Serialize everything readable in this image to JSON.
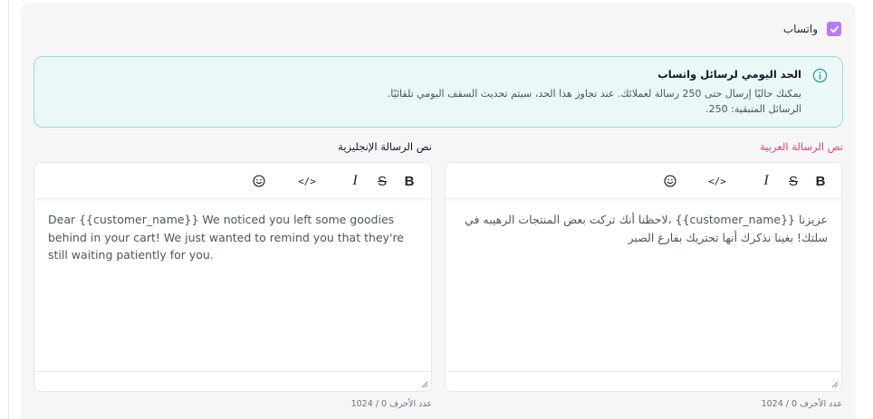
{
  "whatsapp": {
    "checkbox_label": "واتساب",
    "checked": true
  },
  "info_box": {
    "title": "الحد اليومي لرسائل واتساب",
    "line1": "يمكنك حاليًا إرسال حتى 250 رسالة لعملائك. عند تجاوز هذا الحد، سيتم تحديث السقف اليومي تلقائيًا.",
    "line2": "الرسائل المتبقية: 250."
  },
  "arabic_editor": {
    "label": "نص الرسالة العربية",
    "content": "عزيزنا {{customer_name}} ،لاحظنا أنك تركت بعض المنتجات الرهيبه في سلتك! بغينا نذكرك أنها تحتريك بفارغ الصبر",
    "char_count": "عدد الأحرف 0 / 1024"
  },
  "english_editor": {
    "label": "نص الرسالة الإنجليزية",
    "content": "Dear {{customer_name}} We noticed you left some goodies behind in your cart! We just wanted to remind you that they're still waiting patiently for you.",
    "char_count": "عدد الأحرف 0 / 1024"
  },
  "toolbar": {
    "bold": "B",
    "strike": "S",
    "italic": "I",
    "code": "</>",
    "emoji_icon": "smiley-icon"
  },
  "colors": {
    "accent_purple": "#b57cf0",
    "arabic_label_pink": "#e0437b",
    "info_bg": "#eaf8f7",
    "info_border": "#9adbd6",
    "info_icon": "#3b9b8f"
  }
}
